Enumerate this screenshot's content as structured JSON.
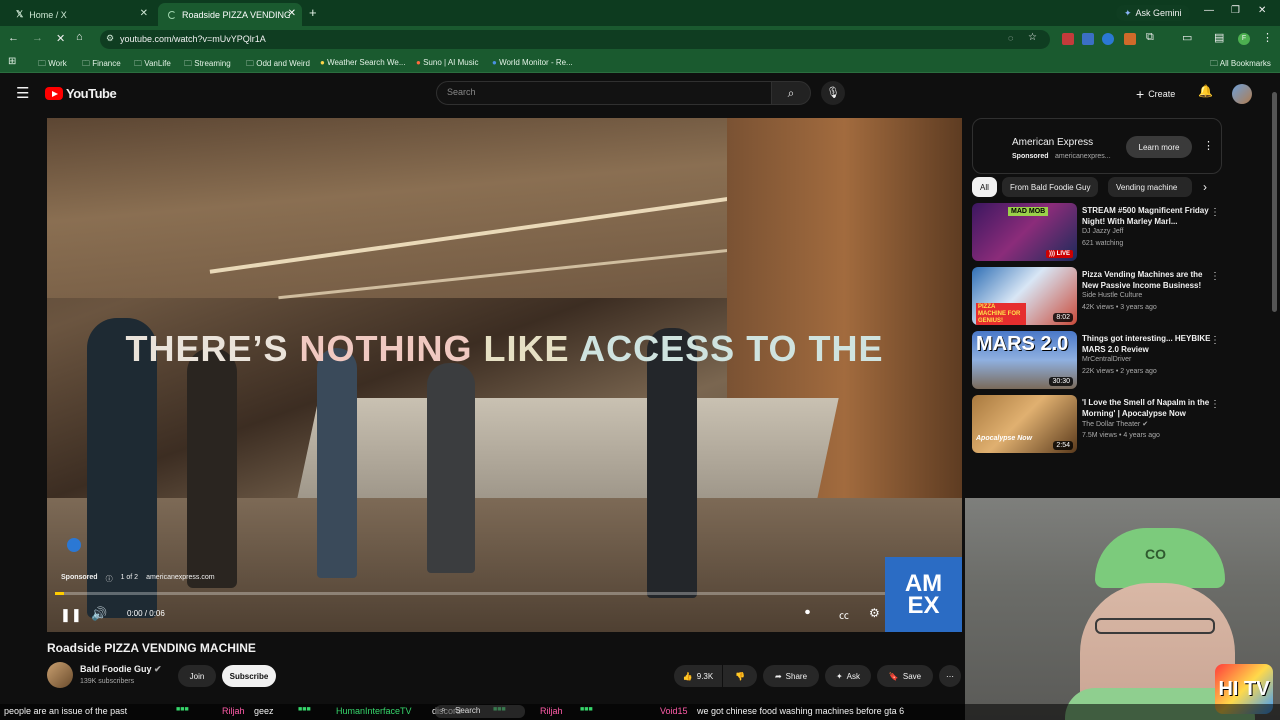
{
  "browser": {
    "tabs": [
      {
        "label": "Home / X",
        "active": false
      },
      {
        "label": "Roadside PIZZA VENDING MA",
        "active": true
      }
    ],
    "new_tab": "+",
    "ask_gemini": "Ask Gemini",
    "url": "youtube.com/watch?v=mUvYPQlr1A",
    "bookmarks": [
      "Work",
      "Finance",
      "VanLife",
      "Streaming",
      "Odd and Weird",
      "Weather Search We...",
      "Suno | AI Music",
      "World Monitor - Re..."
    ],
    "all_bookmarks": "All Bookmarks",
    "accent": "#1a5a2f"
  },
  "youtube": {
    "logo": "YouTube",
    "search_placeholder": "Search",
    "create_label": "Create"
  },
  "video": {
    "overlay_text_a": "THERE’S ",
    "overlay_text_b": "NOTHING ",
    "overlay_text_c": "LIKE ",
    "overlay_text_d": "ACCESS TO THE",
    "sponsored": "Sponsored",
    "ad_count": "1 of 2",
    "ad_domain": "americanexpress.com",
    "time": "0:00 / 0:06",
    "progress": 0.01,
    "amex_line1": "AM",
    "amex_line2": "EX"
  },
  "video_info": {
    "title": "Roadside PIZZA VENDING MACHINE",
    "channel": "Bald Foodie Guy",
    "subscribers": "139K subscribers",
    "join": "Join",
    "subscribe": "Subscribe",
    "likes": "9.3K",
    "share": "Share",
    "ask": "Ask",
    "save": "Save"
  },
  "sidebar": {
    "ad": {
      "title": "American Express",
      "sponsored": "Sponsored",
      "domain": "americanexpres...",
      "cta": "Learn more"
    },
    "chips": [
      "All",
      "From Bald Foodie Guy",
      "Vending machine"
    ],
    "recs": [
      {
        "title": "STREAM #500 Magnificent Friday Night! With Marley Marl...",
        "channel": "DJ Jazzy Jeff",
        "meta": "621 watching",
        "badge": "LIVE",
        "thumb_text": "MAD MOB"
      },
      {
        "title": "Pizza Vending Machines are the New Passive Income Business!",
        "channel": "Side Hustle Culture",
        "meta": "42K views • 3 years ago",
        "duration": "8:02",
        "thumb_text": "PIZZA MACHINE FOR GENIUS!"
      },
      {
        "title": "Things got interesting... HEYBIKE MARS 2.0 Review",
        "channel": "MrCentralDriver",
        "meta": "22K views • 2 years ago",
        "duration": "30:30",
        "thumb_text": "MARS 2.0"
      },
      {
        "title": "'I Love the Smell of Napalm in the Morning' | Apocalypse Now",
        "channel": "The Dollar Theater",
        "meta": "7.5M views • 4 years ago",
        "duration": "2:54",
        "thumb_text": "Apocalypse Now"
      }
    ]
  },
  "webcam": {
    "hat_text": "CO",
    "logo_text": "HI TV"
  },
  "taskbar": {
    "search": "Search"
  },
  "ticker": {
    "t1": "people are an issue of the past",
    "t2": "Riljah",
    "t3": "geez",
    "t4": "HumanInterfaceTV",
    "t5": "discord",
    "t6": "Riljah",
    "t7": "Void15",
    "t8": "we got chinese food washing machines before gta 6"
  }
}
